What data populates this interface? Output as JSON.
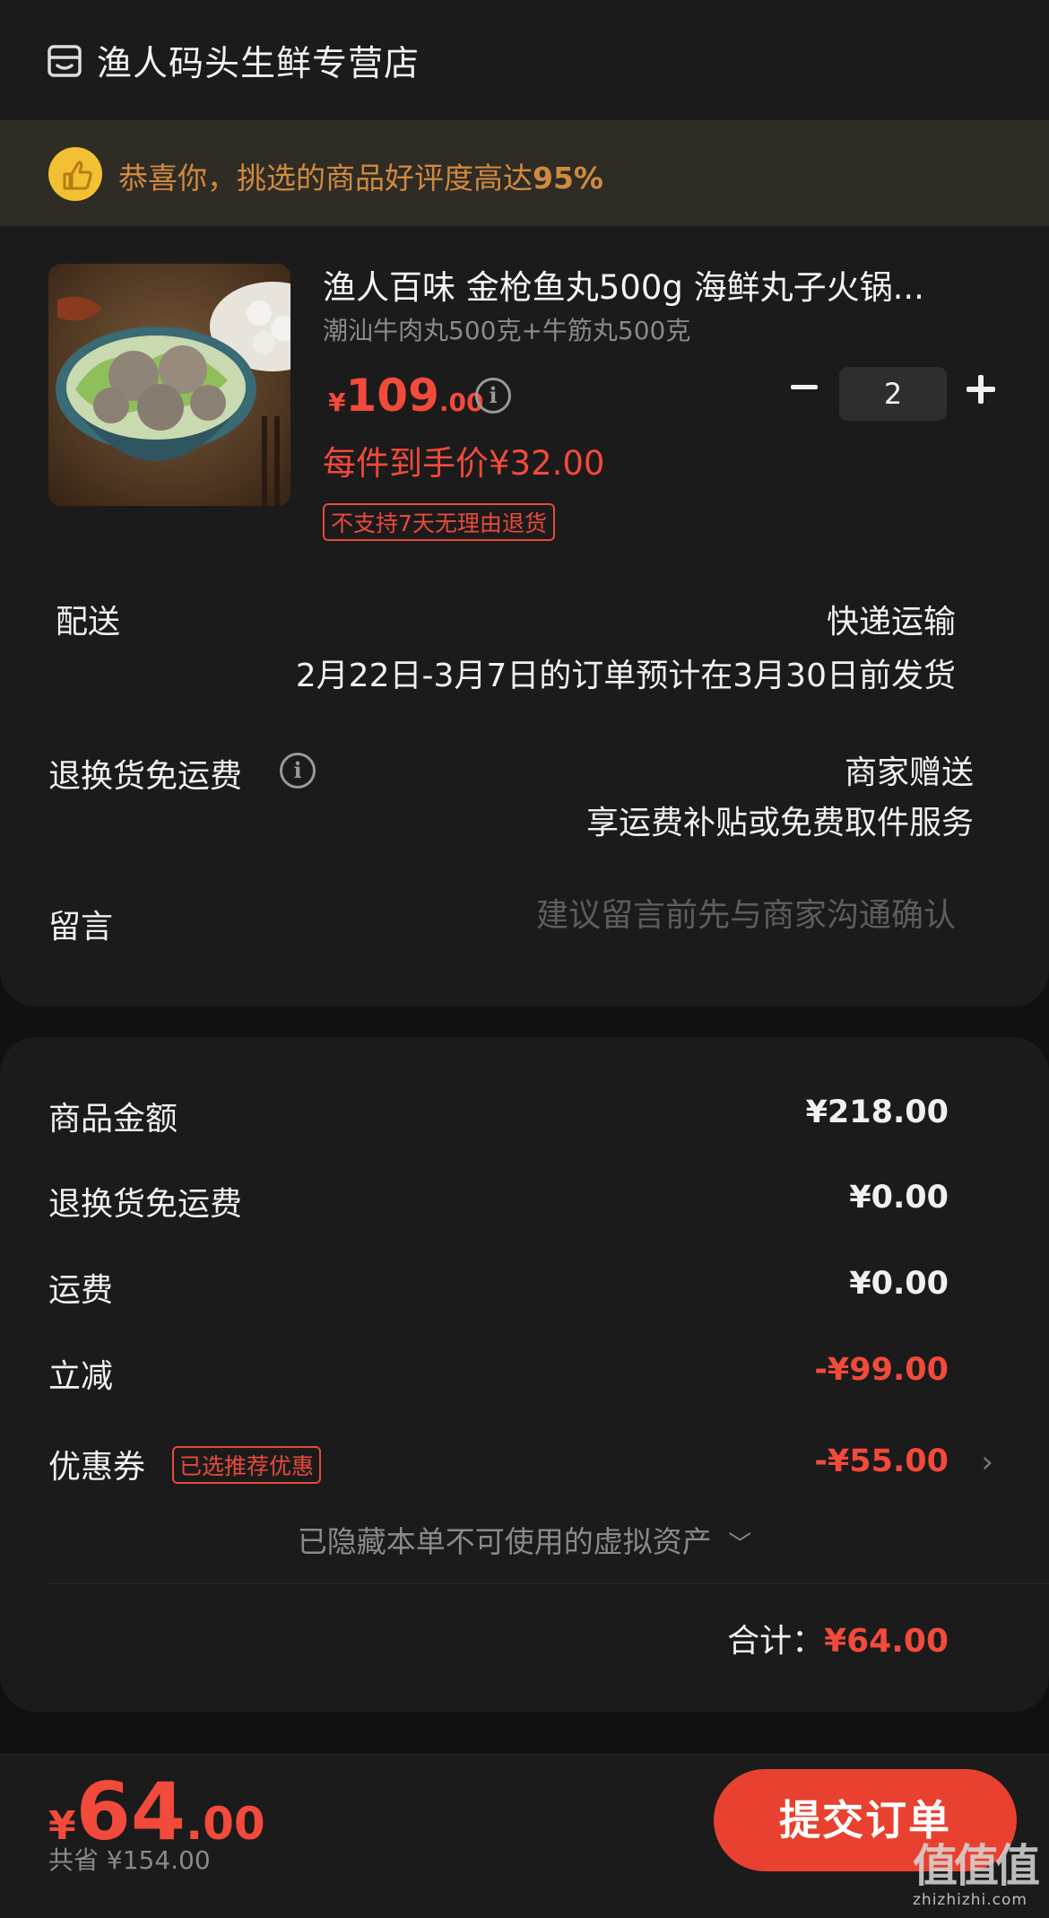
{
  "store": {
    "name": "渔人码头生鲜专营店",
    "icon": "store-icon"
  },
  "banner": {
    "text": "恭喜你，挑选的商品好评度高达",
    "percent": "95%",
    "icon": "thumbs-up-icon"
  },
  "product": {
    "title": "渔人百味 金枪鱼丸500g 海鲜丸子火锅...",
    "spec": "潮汕牛肉丸500克+牛筋丸500克",
    "price_currency": "¥",
    "price_int": "109",
    "price_dec": ".00",
    "per_price": "每件到手价¥32.00",
    "no_return_tag": "不支持7天无理由退货",
    "quantity": "2"
  },
  "delivery": {
    "label": "配送",
    "method": "快递运输",
    "date_note": "2月22日-3月7日的订单预计在3月30日前发货"
  },
  "return_shipping": {
    "label": "退换货免运费",
    "value1": "商家赠送",
    "value2": "享运费补贴或免费取件服务"
  },
  "message": {
    "label": "留言",
    "placeholder": "建议留言前先与商家沟通确认"
  },
  "summary": {
    "goods_label": "商品金额",
    "goods_value": "¥218.00",
    "return_label": "退换货免运费",
    "return_value": "¥0.00",
    "shipping_label": "运费",
    "shipping_value": "¥0.00",
    "discount_label": "立减",
    "discount_value": "-¥99.00",
    "coupon_label": "优惠券",
    "coupon_tag": "已选推荐优惠",
    "coupon_value": "-¥55.00",
    "hidden_assets": "已隐藏本单不可使用的虚拟资产",
    "total_label": "合计：",
    "total_value": "¥64.00"
  },
  "bottom": {
    "pay_currency": "¥",
    "pay_int": "64",
    "pay_dec": ".00",
    "saved": "共省 ¥154.00",
    "submit_label": "提交订单"
  },
  "watermark": {
    "main": "值值值",
    "sub": "zhizhizhi.com"
  },
  "colors": {
    "accent": "#f24a3b",
    "banner_text": "#d08a3e",
    "background": "#111111",
    "card": "#1b1b1b"
  }
}
